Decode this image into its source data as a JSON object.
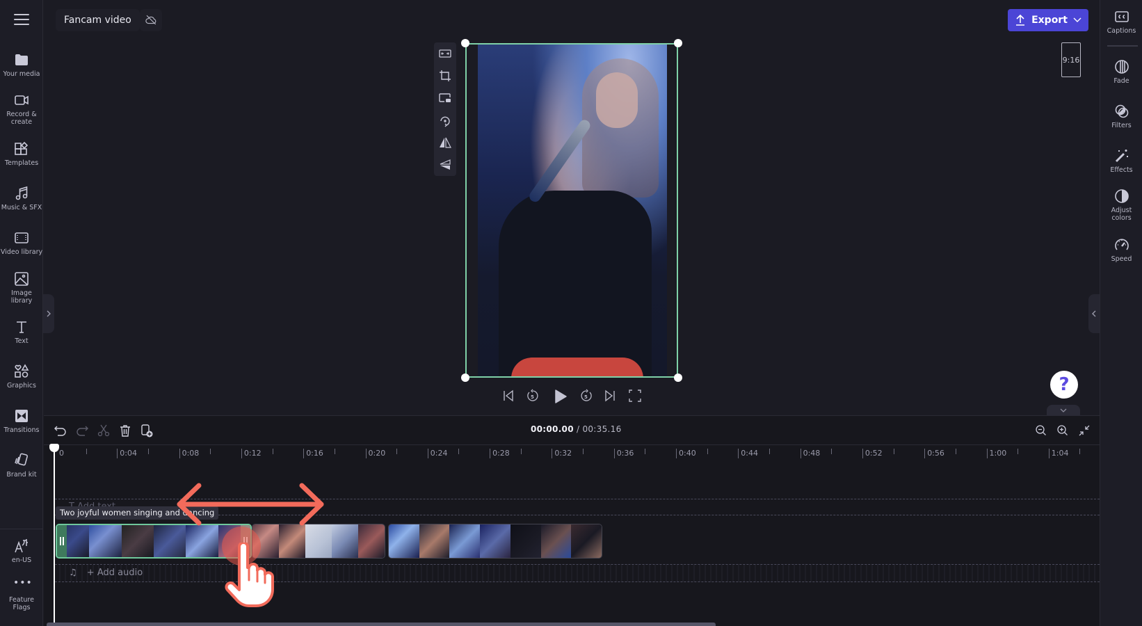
{
  "app": {
    "project_title": "Fancam video",
    "cloud_status_icon": "cloud-off-icon"
  },
  "left_rail": {
    "menu_icon": "hamburger-icon",
    "items": [
      {
        "label": "Your media",
        "icon": "folder-icon"
      },
      {
        "label": "Record &\ncreate",
        "icon": "video-camera-icon"
      },
      {
        "label": "Templates",
        "icon": "templates-icon"
      },
      {
        "label": "Music & SFX",
        "icon": "music-note-icon"
      },
      {
        "label": "Video library",
        "icon": "film-icon"
      },
      {
        "label": "Image\nlibrary",
        "icon": "image-icon"
      },
      {
        "label": "Text",
        "icon": "text-icon"
      },
      {
        "label": "Graphics",
        "icon": "shapes-icon"
      },
      {
        "label": "Transitions",
        "icon": "transition-icon"
      },
      {
        "label": "Brand kit",
        "icon": "brand-kit-icon"
      }
    ],
    "bottom_items": [
      {
        "label": "en-US",
        "icon": "language-icon"
      },
      {
        "label": "Feature\nFlags",
        "icon": "more-dots-icon"
      }
    ]
  },
  "right_rail": {
    "items": [
      {
        "label": "Captions",
        "icon": "captions-cc-icon"
      },
      {
        "label": "Fade",
        "icon": "fade-icon"
      },
      {
        "label": "Filters",
        "icon": "filters-icon"
      },
      {
        "label": "Effects",
        "icon": "magic-wand-icon"
      },
      {
        "label": "Adjust\ncolors",
        "icon": "contrast-icon"
      },
      {
        "label": "Speed",
        "icon": "speedometer-icon"
      }
    ]
  },
  "toolbar": {
    "export_label": "Export",
    "aspect_ratio": "9:16",
    "accent_color": "#4b45d6"
  },
  "preview_tools": [
    "fit-icon",
    "crop-icon",
    "picture-in-picture-icon",
    "rotate-icon",
    "flip-horizontal-icon",
    "flip-vertical-icon"
  ],
  "playback": {
    "buttons": [
      "skip-back-icon",
      "rewind-5-icon",
      "play-icon",
      "forward-5-icon",
      "skip-forward-icon",
      "fullscreen-icon"
    ],
    "rewind_seconds": "5",
    "forward_seconds": "5"
  },
  "help": {
    "label": "?"
  },
  "timeline": {
    "current_time": "00:00.00",
    "separator": " / ",
    "total_time": "00:35.16",
    "ruler_labels": [
      "0",
      "0:04",
      "0:08",
      "0:12",
      "0:16",
      "0:20",
      "0:24",
      "0:28",
      "0:32",
      "0:36",
      "0:40",
      "0:44",
      "0:48",
      "0:52",
      "0:56",
      "1:00",
      "1:04"
    ],
    "text_track_placeholder": "T  Add text",
    "audio_track_placeholder": "+ Add audio",
    "clip_tooltip": "Two joyful women singing and dancing",
    "clips": [
      {
        "name": "clip-1",
        "selected": true
      },
      {
        "name": "clip-2",
        "selected": false
      },
      {
        "name": "clip-3",
        "selected": false
      }
    ],
    "selection_color": "#6fc89c",
    "scroll_fraction": 0.63
  },
  "annotation": {
    "arrow_color": "#f26b5b",
    "gesture": "drag-trim-handle"
  }
}
